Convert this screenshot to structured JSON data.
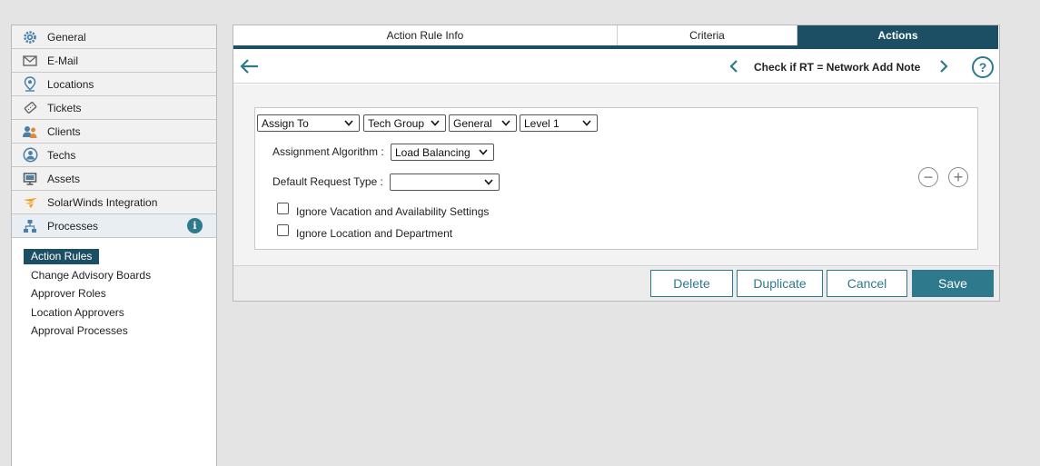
{
  "sidebar": {
    "items": [
      {
        "label": "General",
        "icon": "gear-icon"
      },
      {
        "label": "E-Mail",
        "icon": "envelope-icon"
      },
      {
        "label": "Locations",
        "icon": "location-pin-icon"
      },
      {
        "label": "Tickets",
        "icon": "ticket-icon"
      },
      {
        "label": "Clients",
        "icon": "clients-icon"
      },
      {
        "label": "Techs",
        "icon": "tech-user-icon"
      },
      {
        "label": "Assets",
        "icon": "monitor-icon"
      },
      {
        "label": "SolarWinds Integration",
        "icon": "solarwinds-icon"
      },
      {
        "label": "Processes",
        "icon": "process-tree-icon"
      }
    ],
    "info_glyph": "i",
    "sub_items": [
      {
        "label": "Action Rules"
      },
      {
        "label": "Change Advisory Boards"
      },
      {
        "label": "Approver Roles"
      },
      {
        "label": "Location Approvers"
      },
      {
        "label": "Approval Processes"
      }
    ]
  },
  "tabs": [
    {
      "label": "Action Rule Info"
    },
    {
      "label": "Criteria"
    },
    {
      "label": "Actions"
    }
  ],
  "header": {
    "rule_title": "Check if RT = Network Add Note",
    "help_glyph": "?"
  },
  "action": {
    "selects": [
      "Assign To",
      "Tech Group",
      "General",
      "Level 1"
    ],
    "assignment_algorithm_label": "Assignment Algorithm :",
    "assignment_algorithm_value": "Load Balancing",
    "default_request_type_label": "Default Request Type :",
    "default_request_type_value": "",
    "checkbox_vacation_label": "Ignore Vacation and Availability Settings",
    "checkbox_location_label": "Ignore Location and Department",
    "remove_glyph": "−",
    "add_glyph": "+"
  },
  "footer": {
    "delete_label": "Delete",
    "duplicate_label": "Duplicate",
    "cancel_label": "Cancel",
    "save_label": "Save"
  },
  "colors": {
    "accent": "#2e7a8c",
    "tab_active": "#1d4f64"
  }
}
